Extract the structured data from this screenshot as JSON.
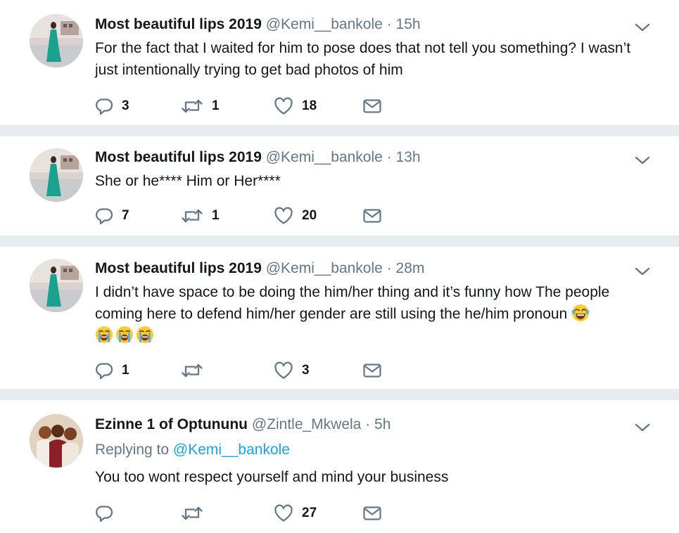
{
  "tweets": [
    {
      "name": "Most beautiful lips 2019",
      "handle": "@Kemi__bankole",
      "dot": "·",
      "time": "15h",
      "text": "For the fact that I waited for him to pose does that not tell you something? I wasn’t just intentionally trying to get bad photos of him",
      "replies": "3",
      "retweets": "1",
      "likes": "18"
    },
    {
      "name": "Most beautiful lips 2019",
      "handle": "@Kemi__bankole",
      "dot": "·",
      "time": "13h",
      "text": "She or he**** Him or Her****",
      "replies": "7",
      "retweets": "1",
      "likes": "20"
    },
    {
      "name": "Most beautiful lips 2019",
      "handle": "@Kemi__bankole",
      "dot": "·",
      "time": "28m",
      "text": "I didn’t have space to be doing the him/her thing and it’s funny how The people coming here to defend him/her gender are still using the he/him pronoun",
      "emojis": [
        "tears-of-joy-emoji",
        "loudly-crying-emoji",
        "loudly-crying-emoji",
        "loudly-crying-emoji"
      ],
      "replies": "1",
      "retweets": "",
      "likes": "3"
    },
    {
      "name": "Ezinne 1 of Optununu",
      "handle": "@Zintle_Mkwela",
      "dot": "·",
      "time": "5h",
      "replying_label": "Replying to",
      "replying_to": "@Kemi__bankole",
      "text": "You too wont respect yourself and mind your business",
      "replies": "",
      "retweets": "",
      "likes": "27"
    }
  ],
  "icons": {
    "reply": "reply-icon",
    "retweet": "retweet-icon",
    "like": "heart-icon",
    "dm": "envelope-icon",
    "menu": "chevron-down-icon"
  },
  "colors": {
    "icon": "#657786",
    "link": "#1da1f2",
    "separator": "#e6ecf0"
  }
}
